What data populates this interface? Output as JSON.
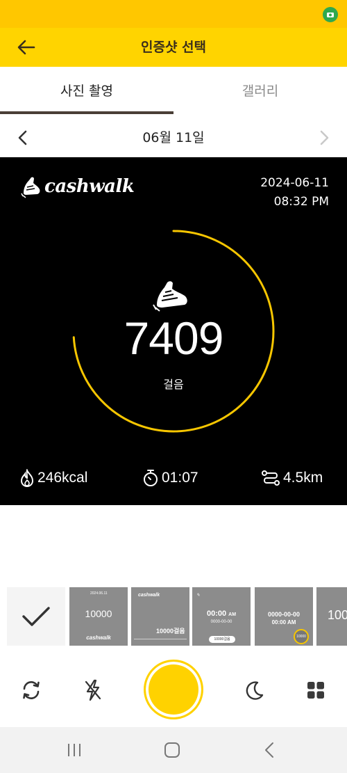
{
  "header": {
    "title": "인증샷 선택",
    "back_icon": "arrow-left-icon",
    "background": "#ffd400"
  },
  "tabs": [
    {
      "label": "사진 촬영",
      "active": true
    },
    {
      "label": "갤러리",
      "active": false
    }
  ],
  "date_nav": {
    "label": "06월 11일",
    "prev_icon": "chevron-left-icon",
    "next_icon": "chevron-right-icon"
  },
  "proof": {
    "brand": "cashwalk",
    "date": "2024-06-11",
    "time": "08:32 PM",
    "steps": "7409",
    "steps_unit": "걸음",
    "step_progress": 0.74,
    "ring_color": "#f7c600",
    "calories": "246kcal",
    "duration": "01:07",
    "distance": "4.5km"
  },
  "templates": {
    "t1": {
      "date_small": "2024.06.11",
      "steps": "10000",
      "brand": "cashwalk"
    },
    "t2": {
      "brand": "cashwalk",
      "steps": "10000걸음"
    },
    "t3": {
      "time": "00:00",
      "ampm": "AM",
      "date": "0000-00-00",
      "pill": "10000걸음"
    },
    "t4": {
      "date": "0000-00-00",
      "time": "00:00 AM",
      "badge": "10000"
    },
    "t5": {
      "steps": "100"
    }
  },
  "controls": {
    "rotate_icon": "camera-switch-icon",
    "flash_icon": "flash-off-icon",
    "night_icon": "moon-icon",
    "grid_icon": "grid-icon",
    "shutter_color": "#ffd200"
  },
  "system_nav": {
    "recent_icon": "recent-apps-icon",
    "home_icon": "home-icon",
    "back_icon": "back-chevron-icon"
  }
}
